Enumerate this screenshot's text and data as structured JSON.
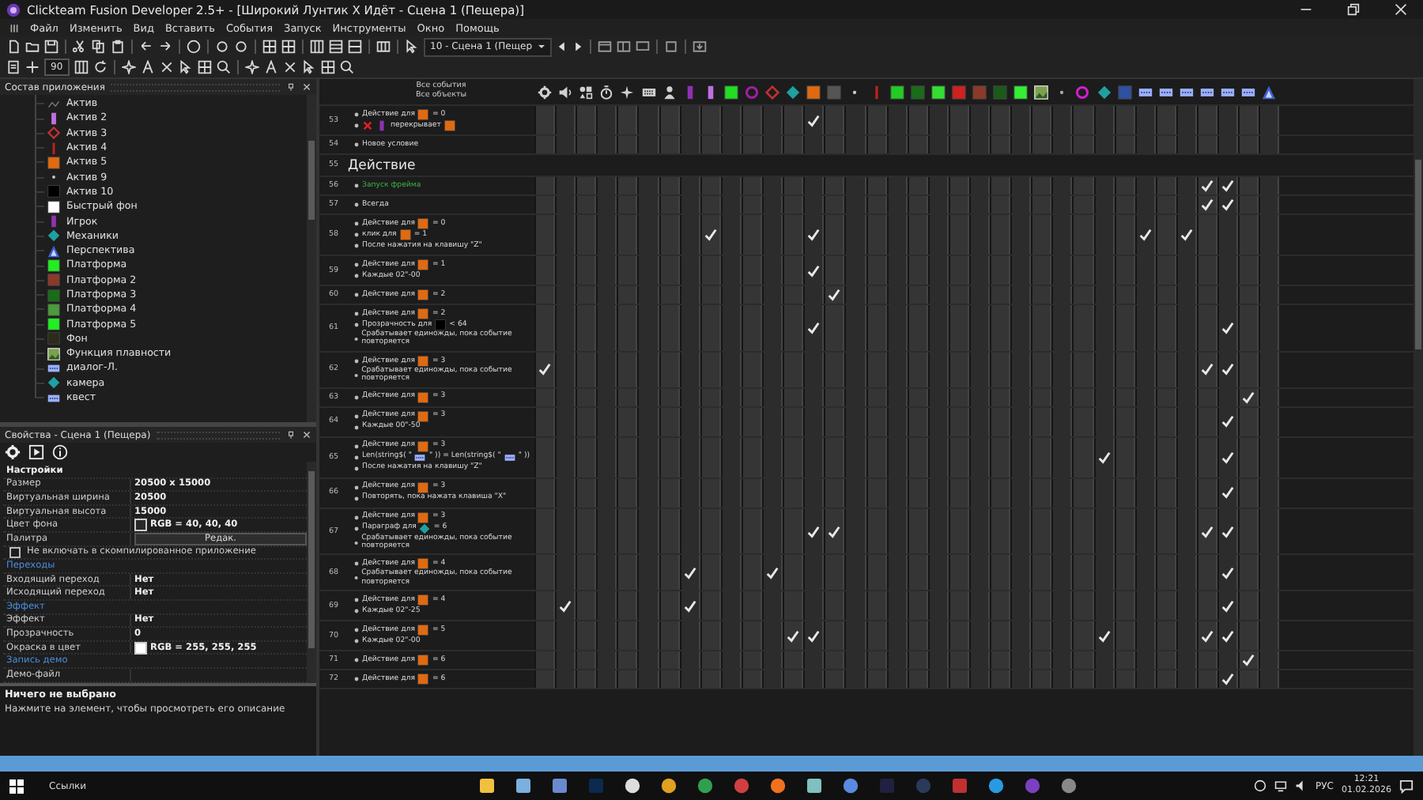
{
  "window": {
    "title": "Clickteam Fusion Developer 2.5+ - [Широкий Лунтик Х Идёт - Сцена 1 (Пещера)]"
  },
  "menu": [
    "Файл",
    "Изменить",
    "Вид",
    "Вставить",
    "События",
    "Запуск",
    "Инструменты",
    "Окно",
    "Помощь"
  ],
  "toolbar": {
    "frame_select": "10 - Сцена 1 (Пещер",
    "zoom_field": "90"
  },
  "workspace": {
    "title": "Состав приложения",
    "items": [
      {
        "label": "Актив",
        "kind": "faint",
        "color": "#777777"
      },
      {
        "label": "Актив 2",
        "kind": "bar",
        "color": "#c070e0"
      },
      {
        "label": "Актив 3",
        "kind": "diamond-outline",
        "color": "#c03030"
      },
      {
        "label": "Актив 4",
        "kind": "thin-bar",
        "color": "#c02020"
      },
      {
        "label": "Актив 5",
        "kind": "square",
        "color": "#e06a10"
      },
      {
        "label": "Актив 9",
        "kind": "dot",
        "color": "#cccccc"
      },
      {
        "label": "Актив 10",
        "kind": "square",
        "color": "#000000"
      },
      {
        "label": "Быстрый фон",
        "kind": "square",
        "color": "#ffffff"
      },
      {
        "label": "Игрок",
        "kind": "bar",
        "color": "#9030b0"
      },
      {
        "label": "Механики",
        "kind": "diamond",
        "color": "#20a0a0"
      },
      {
        "label": "Перспектива",
        "kind": "triangle",
        "color": "#4060d0"
      },
      {
        "label": "Платформа",
        "kind": "square",
        "color": "#22ee22"
      },
      {
        "label": "Платформа 2",
        "kind": "square",
        "color": "#8b3a2a"
      },
      {
        "label": "Платформа 3",
        "kind": "square",
        "color": "#1a6b1a"
      },
      {
        "label": "Платформа 4",
        "kind": "square",
        "color": "#4c9a3c"
      },
      {
        "label": "Платформа 5",
        "kind": "square",
        "color": "#22ee22"
      },
      {
        "label": "Фон",
        "kind": "square",
        "color": "#2b2a1c"
      },
      {
        "label": "Функция плавности",
        "kind": "image",
        "color": "#7aa050"
      },
      {
        "label": "диалог-Л.",
        "kind": "dialog",
        "color": "#9ab0ff"
      },
      {
        "label": "камера",
        "kind": "diamond",
        "color": "#20a0a0"
      },
      {
        "label": "квест",
        "kind": "dialog",
        "color": "#9ab0ff"
      }
    ]
  },
  "properties": {
    "title": "Свойства - Сцена 1 (Пещера)",
    "rows": [
      {
        "kind": "section",
        "label": "Настройки"
      },
      {
        "kind": "prop",
        "label": "Размер",
        "value": "20500 x 15000"
      },
      {
        "kind": "prop",
        "label": "Виртуальная ширина",
        "value": "20500"
      },
      {
        "kind": "prop",
        "label": "Виртуальная высота",
        "value": "15000"
      },
      {
        "kind": "color",
        "label": "Цвет фона",
        "value": "RGB = 40, 40, 40",
        "color": "#282828"
      },
      {
        "kind": "button",
        "label": "Палитра",
        "value": "Редак."
      },
      {
        "kind": "checkbox",
        "label": "Не включать в скомпилированное приложение",
        "checked": false
      },
      {
        "kind": "category",
        "label": "Переходы"
      },
      {
        "kind": "prop",
        "label": "Входящий переход",
        "value": "Нет"
      },
      {
        "kind": "prop",
        "label": "Исходящий переход",
        "value": "Нет"
      },
      {
        "kind": "category",
        "label": "Эффект"
      },
      {
        "kind": "prop",
        "label": "Эффект",
        "value": "Нет"
      },
      {
        "kind": "prop",
        "label": "Прозрачность",
        "value": "0"
      },
      {
        "kind": "color",
        "label": "Окраска в цвет",
        "value": "RGB = 255, 255, 255",
        "color": "#ffffff"
      },
      {
        "kind": "category",
        "label": "Запись демо"
      },
      {
        "kind": "prop",
        "label": "Демо-файл"
      }
    ]
  },
  "info": {
    "title": "Ничего не выбрано",
    "text": "Нажмите на элемент, чтобы просмотреть его описание"
  },
  "event_editor": {
    "header": [
      "Все события",
      "Все объекты"
    ],
    "columns": [
      {
        "kind": "gear",
        "color": "#d0d0d0"
      },
      {
        "kind": "speaker",
        "color": "#d0d0d0"
      },
      {
        "kind": "storyboard",
        "color": "#d0d0d0"
      },
      {
        "kind": "timer",
        "color": "#d0d0d0"
      },
      {
        "kind": "create",
        "color": "#d0d0d0"
      },
      {
        "kind": "keyboard",
        "color": "#d0d0d0"
      },
      {
        "kind": "player",
        "color": "#d0d0d0"
      },
      {
        "kind": "bar",
        "color": "#9030b0"
      },
      {
        "kind": "bar",
        "color": "#c070e0"
      },
      {
        "kind": "square",
        "color": "#22dd22"
      },
      {
        "kind": "ring",
        "color": "#a020a0"
      },
      {
        "kind": "diamond-outline",
        "color": "#c03030"
      },
      {
        "kind": "diamond",
        "color": "#20a0a0"
      },
      {
        "kind": "square",
        "color": "#e06a10"
      },
      {
        "kind": "square",
        "color": "#555555"
      },
      {
        "kind": "dot",
        "color": "#cccccc"
      },
      {
        "kind": "thin-bar",
        "color": "#c02020"
      },
      {
        "kind": "square",
        "color": "#22cc22"
      },
      {
        "kind": "square",
        "color": "#1a6b1a"
      },
      {
        "kind": "square",
        "color": "#33dd33"
      },
      {
        "kind": "square",
        "color": "#d02020"
      },
      {
        "kind": "square",
        "color": "#8b3a2a"
      },
      {
        "kind": "square",
        "color": "#1a5a1a"
      },
      {
        "kind": "square",
        "color": "#33ee33"
      },
      {
        "kind": "image",
        "color": "#7aa050"
      },
      {
        "kind": "dot",
        "color": "#aaaaaa"
      },
      {
        "kind": "ring",
        "color": "#d020d0"
      },
      {
        "kind": "diamond",
        "color": "#20a0a0"
      },
      {
        "kind": "square",
        "color": "#3050a0"
      },
      {
        "kind": "dialog",
        "color": "#9ab0ff"
      },
      {
        "kind": "dialog",
        "color": "#9ab0ff"
      },
      {
        "kind": "dialog",
        "color": "#9ab0ff"
      },
      {
        "kind": "dialog",
        "color": "#9ab0ff"
      },
      {
        "kind": "dialog",
        "color": "#9ab0ff"
      },
      {
        "kind": "dialog",
        "color": "#9ab0ff"
      },
      {
        "kind": "triangle",
        "color": "#4060d0"
      }
    ],
    "events": [
      {
        "kind": "event",
        "number": "53",
        "lines": [
          [
            {
              "text": "Действие для"
            },
            {
              "kind": "square",
              "color": "#e06a10"
            },
            {
              "text": "= 0"
            }
          ],
          [
            {
              "kind": "cross",
              "color": "#e02020"
            },
            {
              "kind": "bar",
              "color": "#9030b0"
            },
            {
              "text": "перекрывает"
            },
            {
              "kind": "square",
              "color": "#e06a10"
            }
          ]
        ],
        "checks": [
          false,
          false,
          false,
          false,
          false,
          false,
          false,
          false,
          false,
          false,
          false,
          false,
          false,
          true,
          false,
          false,
          false,
          false,
          false,
          false,
          false,
          false,
          false,
          false,
          false,
          false,
          false,
          false,
          false,
          false,
          false,
          false,
          false,
          false,
          false,
          false
        ]
      },
      {
        "kind": "event",
        "number": "54",
        "lines": [
          [
            {
              "text": "Новое условие"
            }
          ]
        ],
        "checks": [
          false,
          false,
          false,
          false,
          false,
          false,
          false,
          false,
          false,
          false,
          false,
          false,
          false,
          false,
          false,
          false,
          false,
          false,
          false,
          false,
          false,
          false,
          false,
          false,
          false,
          false,
          false,
          false,
          false,
          false,
          false,
          false,
          false,
          false,
          false,
          false
        ]
      },
      {
        "kind": "group",
        "number": "55",
        "title": "Действие"
      },
      {
        "kind": "event",
        "number": "56",
        "lines": [
          [
            {
              "text": "Запуск фрейма",
              "color": "#3cb043"
            }
          ]
        ],
        "checks": [
          false,
          false,
          false,
          false,
          false,
          false,
          false,
          false,
          false,
          false,
          false,
          false,
          false,
          false,
          false,
          false,
          false,
          false,
          false,
          false,
          false,
          false,
          false,
          false,
          false,
          false,
          false,
          false,
          false,
          false,
          false,
          false,
          true,
          true,
          false,
          false
        ]
      },
      {
        "kind": "event",
        "number": "57",
        "lines": [
          [
            {
              "text": "Всегда"
            }
          ]
        ],
        "checks": [
          false,
          false,
          false,
          false,
          false,
          false,
          false,
          false,
          false,
          false,
          false,
          false,
          false,
          false,
          false,
          false,
          false,
          false,
          false,
          false,
          false,
          false,
          false,
          false,
          false,
          false,
          false,
          false,
          false,
          false,
          false,
          false,
          true,
          true,
          false,
          false
        ]
      },
      {
        "kind": "event",
        "number": "58",
        "lines": [
          [
            {
              "text": "Действие для"
            },
            {
              "kind": "square",
              "color": "#e06a10"
            },
            {
              "text": "= 0"
            }
          ],
          [
            {
              "text": "клик для"
            },
            {
              "kind": "square",
              "color": "#e06a10"
            },
            {
              "text": "= 1"
            }
          ],
          [
            {
              "text": "После нажатия на клавишу \"Z\""
            }
          ]
        ],
        "checks": [
          false,
          false,
          false,
          false,
          false,
          false,
          false,
          false,
          true,
          false,
          false,
          false,
          false,
          true,
          false,
          false,
          false,
          false,
          false,
          false,
          false,
          false,
          false,
          false,
          false,
          false,
          false,
          false,
          false,
          true,
          false,
          true,
          false,
          false,
          false,
          false
        ]
      },
      {
        "kind": "event",
        "number": "59",
        "lines": [
          [
            {
              "text": "Действие для"
            },
            {
              "kind": "square",
              "color": "#e06a10"
            },
            {
              "text": "= 1"
            }
          ],
          [
            {
              "text": "Каждые 02\"-00"
            }
          ]
        ],
        "checks": [
          false,
          false,
          false,
          false,
          false,
          false,
          false,
          false,
          false,
          false,
          false,
          false,
          false,
          true,
          false,
          false,
          false,
          false,
          false,
          false,
          false,
          false,
          false,
          false,
          false,
          false,
          false,
          false,
          false,
          false,
          false,
          false,
          false,
          false,
          false,
          false
        ]
      },
      {
        "kind": "event",
        "number": "60",
        "lines": [
          [
            {
              "text": "Действие для"
            },
            {
              "kind": "square",
              "color": "#e06a10"
            },
            {
              "text": "= 2"
            }
          ]
        ],
        "checks": [
          false,
          false,
          false,
          false,
          false,
          false,
          false,
          false,
          false,
          false,
          false,
          false,
          false,
          false,
          true,
          false,
          false,
          false,
          false,
          false,
          false,
          false,
          false,
          false,
          false,
          false,
          false,
          false,
          false,
          false,
          false,
          false,
          false,
          false,
          false,
          false
        ]
      },
      {
        "kind": "event",
        "number": "61",
        "lines": [
          [
            {
              "text": "Действие для"
            },
            {
              "kind": "square",
              "color": "#e06a10"
            },
            {
              "text": "= 2"
            }
          ],
          [
            {
              "text": "Прозрачность для"
            },
            {
              "kind": "square",
              "color": "#000000"
            },
            {
              "text": "< 64"
            }
          ],
          [
            {
              "text": "Срабатывает единожды, пока событие повторяется"
            }
          ]
        ],
        "checks": [
          false,
          false,
          false,
          false,
          false,
          false,
          false,
          false,
          false,
          false,
          false,
          false,
          false,
          true,
          false,
          false,
          false,
          false,
          false,
          false,
          false,
          false,
          false,
          false,
          false,
          false,
          false,
          false,
          false,
          false,
          false,
          false,
          false,
          true,
          false,
          false
        ]
      },
      {
        "kind": "event",
        "number": "62",
        "lines": [
          [
            {
              "text": "Действие для"
            },
            {
              "kind": "square",
              "color": "#e06a10"
            },
            {
              "text": "= 3"
            }
          ],
          [
            {
              "text": "Срабатывает единожды, пока событие повторяется"
            }
          ]
        ],
        "checks": [
          true,
          false,
          false,
          false,
          false,
          false,
          false,
          false,
          false,
          false,
          false,
          false,
          false,
          false,
          false,
          false,
          false,
          false,
          false,
          false,
          false,
          false,
          false,
          false,
          false,
          false,
          false,
          false,
          false,
          false,
          false,
          false,
          true,
          true,
          false,
          false
        ]
      },
      {
        "kind": "event",
        "number": "63",
        "lines": [
          [
            {
              "text": "Действие для"
            },
            {
              "kind": "square",
              "color": "#e06a10"
            },
            {
              "text": "= 3"
            }
          ]
        ],
        "checks": [
          false,
          false,
          false,
          false,
          false,
          false,
          false,
          false,
          false,
          false,
          false,
          false,
          false,
          false,
          false,
          false,
          false,
          false,
          false,
          false,
          false,
          false,
          false,
          false,
          false,
          false,
          false,
          false,
          false,
          false,
          false,
          false,
          false,
          false,
          true,
          false
        ]
      },
      {
        "kind": "event",
        "number": "64",
        "lines": [
          [
            {
              "text": "Действие для"
            },
            {
              "kind": "square",
              "color": "#e06a10"
            },
            {
              "text": "= 3"
            }
          ],
          [
            {
              "text": "Каждые 00\"-50"
            }
          ]
        ],
        "checks": [
          false,
          false,
          false,
          false,
          false,
          false,
          false,
          false,
          false,
          false,
          false,
          false,
          false,
          false,
          false,
          false,
          false,
          false,
          false,
          false,
          false,
          false,
          false,
          false,
          false,
          false,
          false,
          false,
          false,
          false,
          false,
          false,
          false,
          true,
          false,
          false
        ]
      },
      {
        "kind": "event",
        "number": "65",
        "lines": [
          [
            {
              "text": "Действие для"
            },
            {
              "kind": "square",
              "color": "#e06a10"
            },
            {
              "text": "= 3"
            }
          ],
          [
            {
              "text": "Len(string$( \""
            },
            {
              "kind": "dialog",
              "color": "#9ab0ff"
            },
            {
              "text": "\" )) = Len(string$( \""
            },
            {
              "kind": "dialog",
              "color": "#9ab0ff"
            },
            {
              "text": "\" ))"
            }
          ],
          [
            {
              "text": "После нажатия на клавишу \"Z\""
            }
          ]
        ],
        "checks": [
          false,
          false,
          false,
          false,
          false,
          false,
          false,
          false,
          false,
          false,
          false,
          false,
          false,
          false,
          false,
          false,
          false,
          false,
          false,
          false,
          false,
          false,
          false,
          false,
          false,
          false,
          false,
          true,
          false,
          false,
          false,
          false,
          false,
          true,
          false,
          false
        ]
      },
      {
        "kind": "event",
        "number": "66",
        "lines": [
          [
            {
              "text": "Действие для"
            },
            {
              "kind": "square",
              "color": "#e06a10"
            },
            {
              "text": "= 3"
            }
          ],
          [
            {
              "text": "Повторять, пока нажата клавиша \"X\""
            }
          ]
        ],
        "checks": [
          false,
          false,
          false,
          false,
          false,
          false,
          false,
          false,
          false,
          false,
          false,
          false,
          false,
          false,
          false,
          false,
          false,
          false,
          false,
          false,
          false,
          false,
          false,
          false,
          false,
          false,
          false,
          false,
          false,
          false,
          false,
          false,
          false,
          true,
          false,
          false
        ]
      },
      {
        "kind": "event",
        "number": "67",
        "lines": [
          [
            {
              "text": "Действие для"
            },
            {
              "kind": "square",
              "color": "#e06a10"
            },
            {
              "text": "= 3"
            }
          ],
          [
            {
              "text": "Параграф для"
            },
            {
              "kind": "diamond",
              "color": "#20a0a0"
            },
            {
              "text": "= 6"
            }
          ],
          [
            {
              "text": "Срабатывает единожды, пока событие повторяется"
            }
          ]
        ],
        "checks": [
          false,
          false,
          false,
          false,
          false,
          false,
          false,
          false,
          false,
          false,
          false,
          false,
          false,
          true,
          true,
          false,
          false,
          false,
          false,
          false,
          false,
          false,
          false,
          false,
          false,
          false,
          false,
          false,
          false,
          false,
          false,
          false,
          true,
          true,
          false,
          false
        ]
      },
      {
        "kind": "event",
        "number": "68",
        "lines": [
          [
            {
              "text": "Действие для"
            },
            {
              "kind": "square",
              "color": "#e06a10"
            },
            {
              "text": "= 4"
            }
          ],
          [
            {
              "text": "Срабатывает единожды, пока событие повторяется"
            }
          ]
        ],
        "checks": [
          false,
          false,
          false,
          false,
          false,
          false,
          false,
          true,
          false,
          false,
          false,
          true,
          false,
          false,
          false,
          false,
          false,
          false,
          false,
          false,
          false,
          false,
          false,
          false,
          false,
          false,
          false,
          false,
          false,
          false,
          false,
          false,
          false,
          true,
          false,
          false
        ]
      },
      {
        "kind": "event",
        "number": "69",
        "lines": [
          [
            {
              "text": "Действие для"
            },
            {
              "kind": "square",
              "color": "#e06a10"
            },
            {
              "text": "= 4"
            }
          ],
          [
            {
              "text": "Каждые 02\"-25"
            }
          ]
        ],
        "checks": [
          false,
          true,
          false,
          false,
          false,
          false,
          false,
          true,
          false,
          false,
          false,
          false,
          false,
          false,
          false,
          false,
          false,
          false,
          false,
          false,
          false,
          false,
          false,
          false,
          false,
          false,
          false,
          false,
          false,
          false,
          false,
          false,
          false,
          true,
          false,
          false
        ]
      },
      {
        "kind": "event",
        "number": "70",
        "lines": [
          [
            {
              "text": "Действие для"
            },
            {
              "kind": "square",
              "color": "#e06a10"
            },
            {
              "text": "= 5"
            }
          ],
          [
            {
              "text": "Каждые 02\"-00"
            }
          ]
        ],
        "checks": [
          false,
          false,
          false,
          false,
          false,
          false,
          false,
          false,
          false,
          false,
          false,
          false,
          true,
          true,
          false,
          false,
          false,
          false,
          false,
          false,
          false,
          false,
          false,
          false,
          false,
          false,
          false,
          true,
          false,
          false,
          false,
          false,
          true,
          true,
          false,
          false
        ]
      },
      {
        "kind": "event",
        "number": "71",
        "lines": [
          [
            {
              "text": "Действие для"
            },
            {
              "kind": "square",
              "color": "#e06a10"
            },
            {
              "text": "= 6"
            }
          ]
        ],
        "checks": [
          false,
          false,
          false,
          false,
          false,
          false,
          false,
          false,
          false,
          false,
          false,
          false,
          false,
          false,
          false,
          false,
          false,
          false,
          false,
          false,
          false,
          false,
          false,
          false,
          false,
          false,
          false,
          false,
          false,
          false,
          false,
          false,
          false,
          false,
          true,
          false
        ]
      },
      {
        "kind": "event",
        "number": "72",
        "lines": [
          [
            {
              "text": "Действие для"
            },
            {
              "kind": "square",
              "color": "#e06a10"
            },
            {
              "text": "= 6"
            }
          ]
        ],
        "checks": [
          false,
          false,
          false,
          false,
          false,
          false,
          false,
          false,
          false,
          false,
          false,
          false,
          false,
          false,
          false,
          false,
          false,
          false,
          false,
          false,
          false,
          false,
          false,
          false,
          false,
          false,
          false,
          false,
          false,
          false,
          false,
          false,
          false,
          true,
          false,
          false
        ]
      }
    ]
  },
  "taskbar": {
    "links": "Ссылки",
    "language": "РУС",
    "time": "12:21",
    "date": "01.02.2026"
  }
}
